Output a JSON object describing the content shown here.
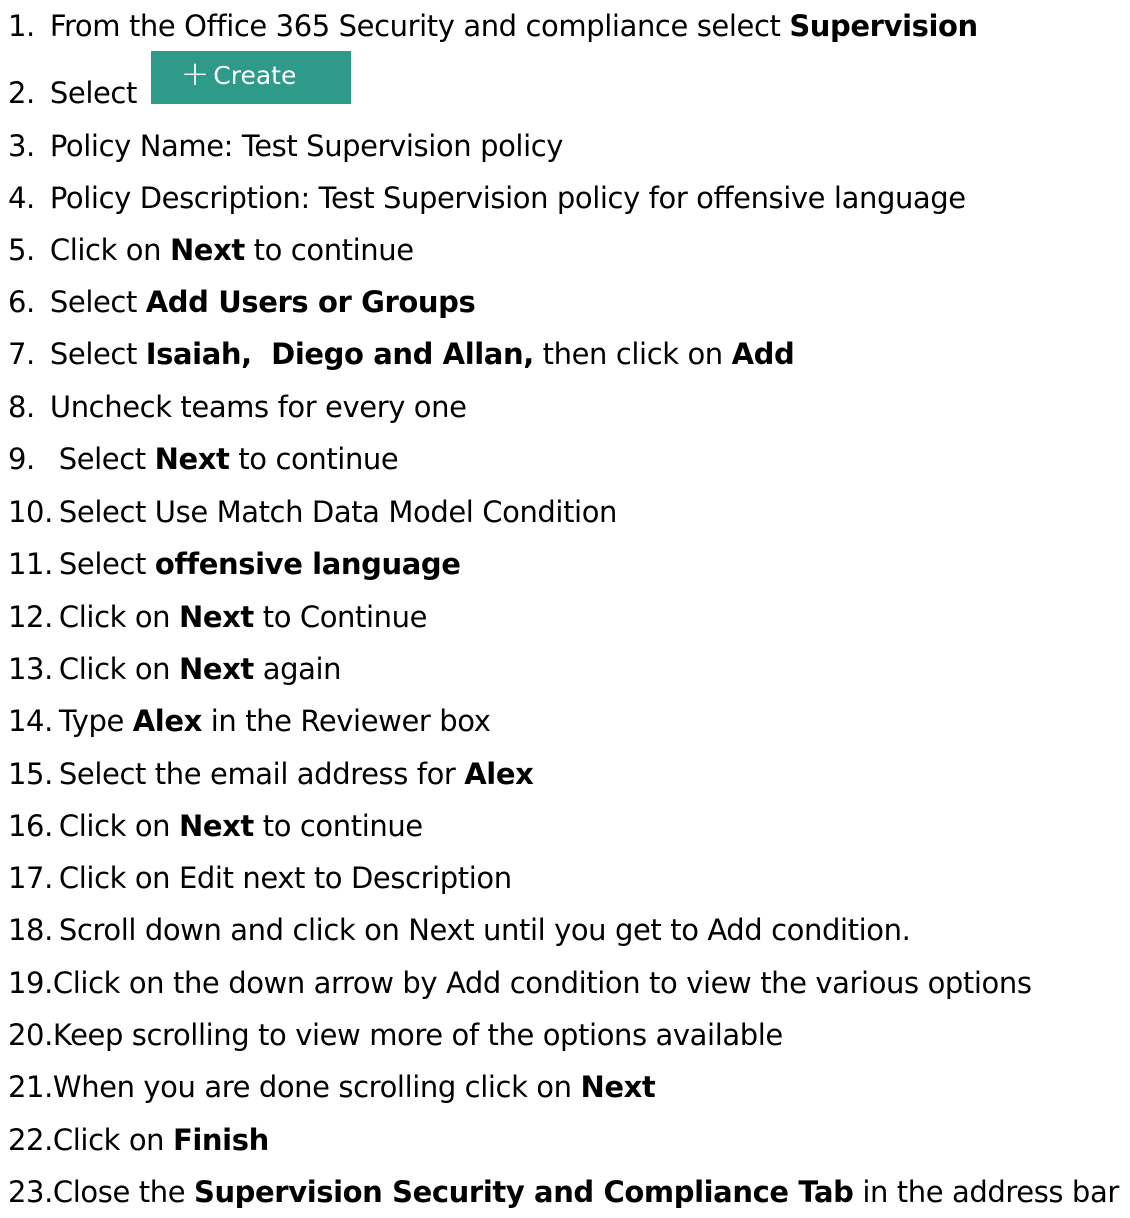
{
  "steps": [
    {
      "num": "1.",
      "segments": [
        {
          "text": "From the Office 365 Security and compliance select ",
          "bold": false
        },
        {
          "text": "Supervision",
          "bold": true
        }
      ]
    },
    {
      "num": "2.",
      "segments": [
        {
          "text": "Select ",
          "bold": false
        }
      ],
      "button": {
        "icon": "plus-icon",
        "label": "Create",
        "color": "#2e9a8a"
      }
    },
    {
      "num": "3.",
      "segments": [
        {
          "text": "Policy Name: Test Supervision policy",
          "bold": false
        }
      ]
    },
    {
      "num": "4.",
      "segments": [
        {
          "text": "Policy Description: Test Supervision policy for offensive language",
          "bold": false
        }
      ]
    },
    {
      "num": "5.",
      "segments": [
        {
          "text": "Click on ",
          "bold": false
        },
        {
          "text": "Next",
          "bold": true
        },
        {
          "text": " to continue",
          "bold": false
        }
      ]
    },
    {
      "num": "6.",
      "segments": [
        {
          "text": "Select ",
          "bold": false
        },
        {
          "text": "Add Users or Groups",
          "bold": true
        }
      ]
    },
    {
      "num": "7.",
      "segments": [
        {
          "text": "Select ",
          "bold": false
        },
        {
          "text": "Isaiah,  Diego and Allan,",
          "bold": true
        },
        {
          "text": " then click on ",
          "bold": false
        },
        {
          "text": "Add",
          "bold": true
        }
      ]
    },
    {
      "num": "8.",
      "segments": [
        {
          "text": "Uncheck teams for every one",
          "bold": false
        }
      ]
    },
    {
      "num": "9.",
      "segments": [
        {
          "text": " Select ",
          "bold": false
        },
        {
          "text": "Next",
          "bold": true
        },
        {
          "text": " to continue",
          "bold": false
        }
      ]
    },
    {
      "num": "10.",
      "segments": [
        {
          "text": "Select Use Match Data Model Condition",
          "bold": false
        }
      ]
    },
    {
      "num": "11.",
      "segments": [
        {
          "text": "Select ",
          "bold": false
        },
        {
          "text": "offensive language",
          "bold": true
        }
      ]
    },
    {
      "num": "12.",
      "segments": [
        {
          "text": "Click on ",
          "bold": false
        },
        {
          "text": "Next",
          "bold": true
        },
        {
          "text": " to Continue",
          "bold": false
        }
      ]
    },
    {
      "num": "13.",
      "segments": [
        {
          "text": "Click on ",
          "bold": false
        },
        {
          "text": "Next",
          "bold": true
        },
        {
          "text": " again",
          "bold": false
        }
      ]
    },
    {
      "num": "14.",
      "segments": [
        {
          "text": "Type ",
          "bold": false
        },
        {
          "text": "Alex",
          "bold": true
        },
        {
          "text": " in the Reviewer box",
          "bold": false
        }
      ]
    },
    {
      "num": "15.",
      "segments": [
        {
          "text": "Select the email address for ",
          "bold": false
        },
        {
          "text": "Alex",
          "bold": true
        }
      ]
    },
    {
      "num": "16.",
      "segments": [
        {
          "text": "Click on ",
          "bold": false
        },
        {
          "text": "Next",
          "bold": true
        },
        {
          "text": " to continue",
          "bold": false
        }
      ]
    },
    {
      "num": "17.",
      "segments": [
        {
          "text": "Click on Edit next to Description",
          "bold": false
        }
      ]
    },
    {
      "num": "18.",
      "segments": [
        {
          "text": "Scroll down and click on Next until you get to Add condition.",
          "bold": false
        }
      ]
    },
    {
      "num": "19.",
      "segments": [
        {
          "text": "Click on the down arrow by Add condition to view the various options",
          "bold": false
        }
      ]
    },
    {
      "num": "20.",
      "segments": [
        {
          "text": "Keep scrolling to view more of the options available",
          "bold": false
        }
      ]
    },
    {
      "num": "21.",
      "segments": [
        {
          "text": "When you are done scrolling click on ",
          "bold": false
        },
        {
          "text": "Next",
          "bold": true
        }
      ]
    },
    {
      "num": "22.",
      "segments": [
        {
          "text": "Click on ",
          "bold": false
        },
        {
          "text": "Finish",
          "bold": true
        }
      ]
    },
    {
      "num": "23.",
      "segments": [
        {
          "text": "Close the ",
          "bold": false
        },
        {
          "text": "Supervision Security and Compliance Tab",
          "bold": true
        },
        {
          "text": " in the address bar",
          "bold": false
        }
      ]
    }
  ]
}
